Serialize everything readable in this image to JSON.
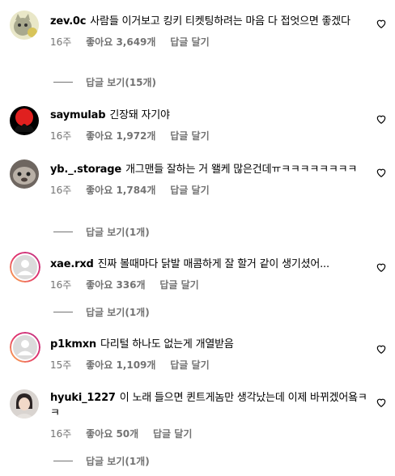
{
  "comments": [
    {
      "username": "zev.0c",
      "text": "사람들 이거보고 킹키 티켓팅하려는 마음 다 접엇으면 좋겠다",
      "time": "16주",
      "likes": "좋아요 3,649개",
      "reply_label": "답글 달기",
      "view_replies": "답글 보기(15개)",
      "avatar": "cat-avatar-icon"
    },
    {
      "username": "saymulab",
      "text": "긴장돼 자기야",
      "time": "16주",
      "likes": "좋아요 1,972개",
      "reply_label": "답글 달기",
      "avatar": "red-circle-avatar-icon"
    },
    {
      "username": "yb._.storage",
      "text": "개그맨들 잘하는 거 왤케 많은건데ㅠㅋㅋㅋㅋㅋㅋㅋㅋ",
      "time": "16주",
      "likes": "좋아요 1,784개",
      "reply_label": "답글 달기",
      "view_replies": "답글 보기(1개)",
      "avatar": "pet-photo-avatar-icon"
    },
    {
      "username": "xae.rxd",
      "text": "진짜 볼때마다 닭발 매콤하게 잘 할거 같이 생기셨어...",
      "time": "16주",
      "likes": "좋아요 336개",
      "reply_label": "답글 달기",
      "view_replies": "답글 보기(1개)",
      "avatar": "default-avatar-icon"
    },
    {
      "username": "p1kmxn",
      "text": "다리털 하나도 없는게 개열받음",
      "time": "15주",
      "likes": "좋아요 1,109개",
      "reply_label": "답글 달기",
      "avatar": "default-avatar-icon"
    },
    {
      "username": "hyuki_1227",
      "text": "이 노래 들으면 퀸트게놈만 생각났는데 이제 바뀌겠어욬ㅋㅋ",
      "time": "16주",
      "likes": "좋아요 50개",
      "reply_label": "답글 달기",
      "view_replies": "답글 보기(1개)",
      "avatar": "person-photo-avatar-icon"
    }
  ],
  "colors": {
    "meta_gray": "#737373",
    "story_ring": "#e1306c"
  }
}
